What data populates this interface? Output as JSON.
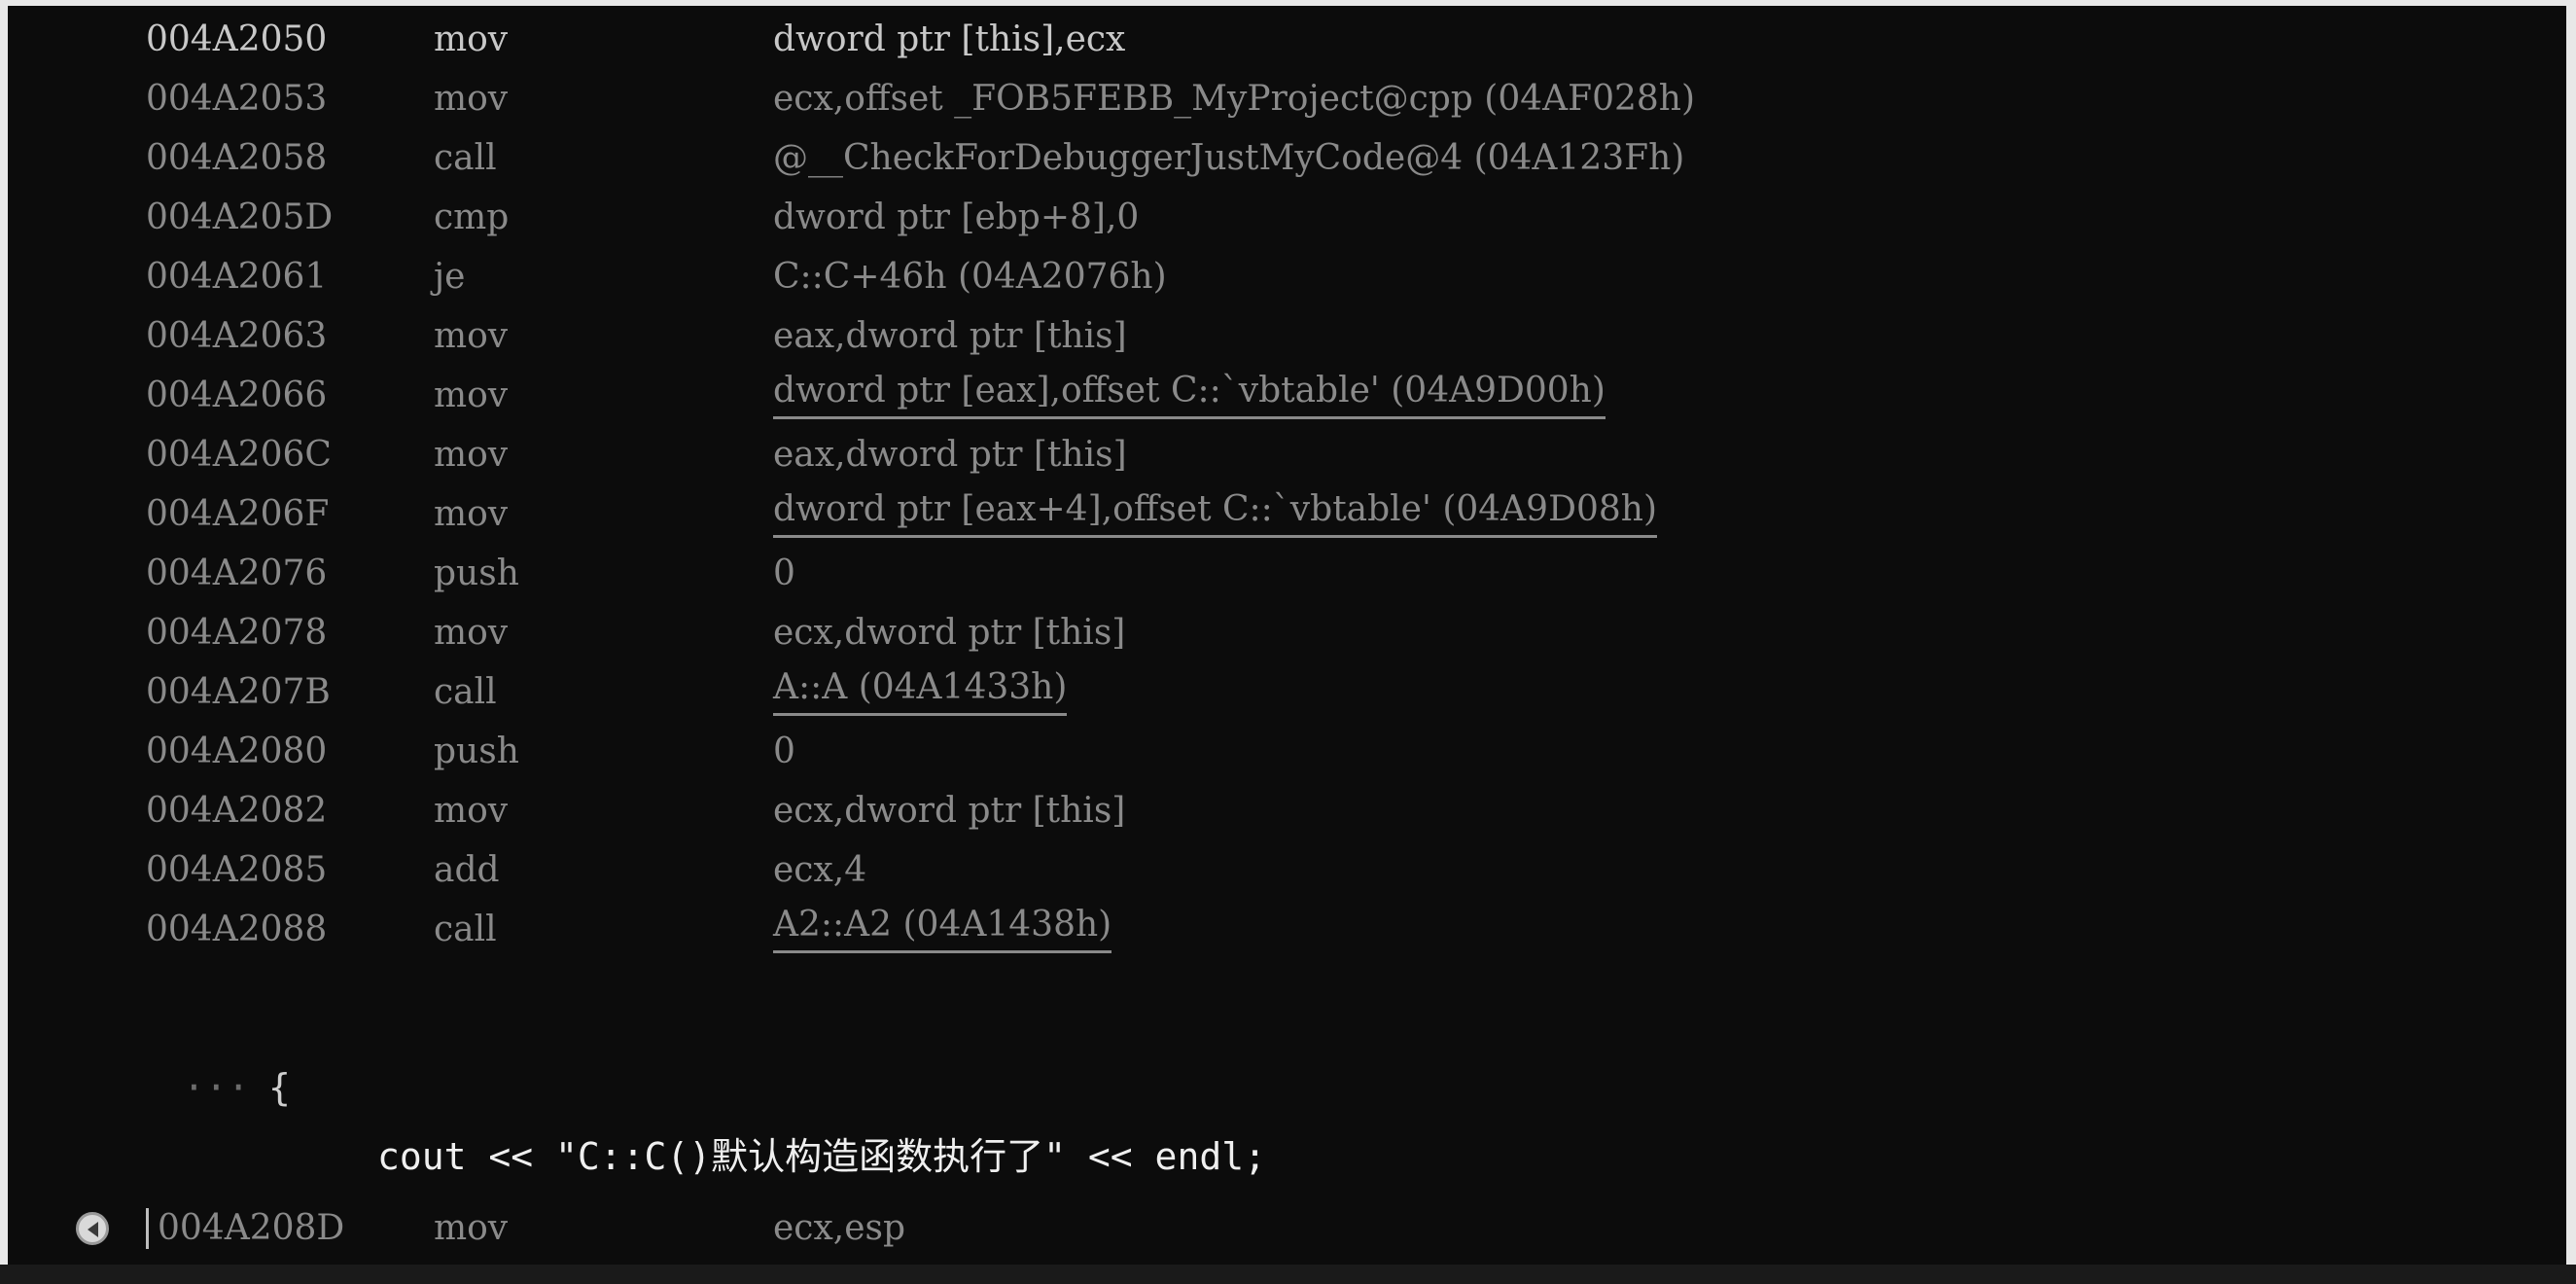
{
  "disassembly": [
    {
      "addr": "004A2050",
      "mnemonic": "mov",
      "operands": "dword ptr [this],ecx",
      "strong": true,
      "underline": false
    },
    {
      "addr": "004A2053",
      "mnemonic": "mov",
      "operands": "ecx,offset _FOB5FEBB_MyProject@cpp (04AF028h)",
      "strong": false,
      "underline": false
    },
    {
      "addr": "004A2058",
      "mnemonic": "call",
      "operands": "@__CheckForDebuggerJustMyCode@4 (04A123Fh)",
      "strong": false,
      "underline": false
    },
    {
      "addr": "004A205D",
      "mnemonic": "cmp",
      "operands": "dword ptr [ebp+8],0",
      "strong": false,
      "underline": false
    },
    {
      "addr": "004A2061",
      "mnemonic": "je",
      "operands": "C::C+46h (04A2076h)",
      "strong": false,
      "underline": false
    },
    {
      "addr": "004A2063",
      "mnemonic": "mov",
      "operands": "eax,dword ptr [this]",
      "strong": false,
      "underline": false
    },
    {
      "addr": "004A2066",
      "mnemonic": "mov",
      "operands": "dword ptr [eax],offset C::`vbtable' (04A9D00h)",
      "strong": false,
      "underline": true
    },
    {
      "addr": "004A206C",
      "mnemonic": "mov",
      "operands": "eax,dword ptr [this]",
      "strong": false,
      "underline": false
    },
    {
      "addr": "004A206F",
      "mnemonic": "mov",
      "operands": "dword ptr [eax+4],offset C::`vbtable' (04A9D08h)",
      "strong": false,
      "underline": true
    },
    {
      "addr": "004A2076",
      "mnemonic": "push",
      "operands": "0",
      "strong": false,
      "underline": false
    },
    {
      "addr": "004A2078",
      "mnemonic": "mov",
      "operands": "ecx,dword ptr [this]",
      "strong": false,
      "underline": false
    },
    {
      "addr": "004A207B",
      "mnemonic": "call",
      "operands": "A::A (04A1433h)",
      "strong": false,
      "underline": true
    },
    {
      "addr": "004A2080",
      "mnemonic": "push",
      "operands": "0",
      "strong": false,
      "underline": false
    },
    {
      "addr": "004A2082",
      "mnemonic": "mov",
      "operands": "ecx,dword ptr [this]",
      "strong": false,
      "underline": false
    },
    {
      "addr": "004A2085",
      "mnemonic": "add",
      "operands": "ecx,4",
      "strong": false,
      "underline": false
    },
    {
      "addr": "004A2088",
      "mnemonic": "call",
      "operands": "A2::A2 (04A1438h)",
      "strong": false,
      "underline": true
    }
  ],
  "brace_line": {
    "prefix": "···",
    "brace": "{"
  },
  "source_line": "cout << \"C::C()默认构造函数执行了\" << endl;",
  "current_line": {
    "addr": "004A208D",
    "mnemonic": "mov",
    "operands": "ecx,esp"
  }
}
